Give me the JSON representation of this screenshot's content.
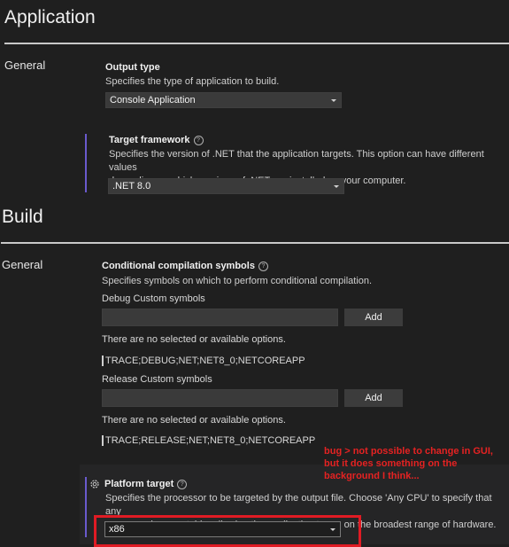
{
  "application": {
    "title": "Application",
    "category": "General",
    "output_type": {
      "label": "Output type",
      "description": "Specifies the type of application to build.",
      "value": "Console Application"
    },
    "target_framework": {
      "label": "Target framework",
      "help": "?",
      "description_line1": "Specifies the version of .NET that the application targets. This option can have different values",
      "description_line2": "depending on which versions of .NET are installed on your computer.",
      "value": ".NET 8.0"
    }
  },
  "build": {
    "title": "Build",
    "category": "General",
    "conditional_symbols": {
      "label": "Conditional compilation symbols",
      "help": "?",
      "description": "Specifies symbols on which to perform conditional compilation.",
      "debug": {
        "label": "Debug Custom symbols",
        "input_value": "",
        "add_label": "Add",
        "empty_text": "There are no selected or available options.",
        "symbols": "TRACE;DEBUG;NET;NET8_0;NETCOREAPP"
      },
      "release": {
        "label": "Release Custom symbols",
        "input_value": "",
        "add_label": "Add",
        "empty_text": "There are no selected or available options.",
        "symbols": "TRACE;RELEASE;NET;NET8_0;NETCOREAPP"
      }
    },
    "platform_target": {
      "label": "Platform target",
      "help": "?",
      "description_line1": "Specifies the processor to be targeted by the output file. Choose 'Any CPU' to specify that any",
      "description_line2": "processor is acceptable, allowing the application to run on the broadest range of hardware.",
      "value": "x86"
    }
  },
  "annotation": {
    "line1": "bug > not possible to change in GUI,",
    "line2": "but it does something on the",
    "line3": "background I think...",
    "color": "#e52222"
  }
}
